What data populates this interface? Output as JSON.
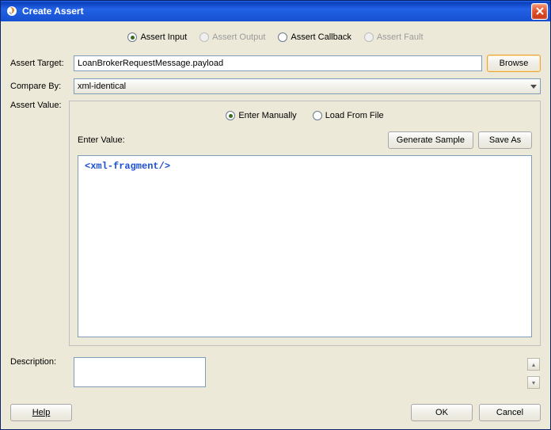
{
  "titlebar": {
    "title": "Create Assert"
  },
  "assert_type": {
    "input": "Assert Input",
    "output": "Assert Output",
    "callback": "Assert Callback",
    "fault": "Assert Fault"
  },
  "labels": {
    "assert_target": "Assert Target:",
    "compare_by": "Compare By:",
    "assert_value": "Assert Value:",
    "enter_value": "Enter Value:",
    "description": "Description:"
  },
  "fields": {
    "assert_target": "LoanBrokerRequestMessage.payload",
    "compare_by": "xml-identical",
    "description": ""
  },
  "value_mode": {
    "enter_manually": "Enter Manually",
    "load_from_file": "Load From File"
  },
  "buttons": {
    "browse": "Browse",
    "generate_sample": "Generate Sample",
    "save_as": "Save As",
    "help": "Help",
    "ok": "OK",
    "cancel": "Cancel"
  },
  "editor": {
    "content": "<xml-fragment/>"
  }
}
